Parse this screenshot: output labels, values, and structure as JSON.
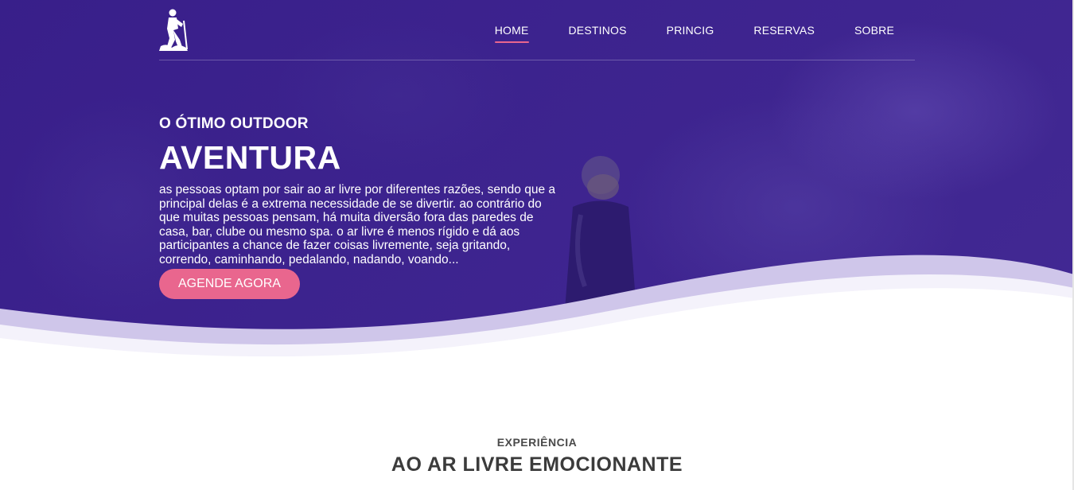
{
  "nav": {
    "items": [
      {
        "label": "HOME",
        "active": true
      },
      {
        "label": "DESTINOS",
        "active": false
      },
      {
        "label": "PRINCIG",
        "active": false
      },
      {
        "label": "RESERVAS",
        "active": false
      },
      {
        "label": "SOBRE",
        "active": false
      }
    ]
  },
  "hero": {
    "subtitle": "O ÓTIMO OUTDOOR",
    "title": "AVENTURA",
    "description": "as pessoas optam por sair ao ar livre por diferentes razões, sendo que a principal delas é a extrema necessidade de se divertir. ao contrário do que muitas pessoas pensam, há muita diversão fora das paredes de casa, bar, clube ou mesmo spa. o ar livre é menos rígido e dá aos participantes a chance de fazer coisas livremente, seja gritando, correndo, caminhando, pedalando, nadando, voando...",
    "cta_label": "AGENDE AGORA"
  },
  "section": {
    "eyebrow": "EXPERIÊNCIA",
    "title": "AO AR LIVRE EMOCIONANTE"
  },
  "colors": {
    "hero_bg": "#3a1f8c",
    "accent": "#e9668e",
    "wave_light": "#c9c0e6"
  },
  "icons": {
    "logo": "hiker-logo-icon"
  }
}
